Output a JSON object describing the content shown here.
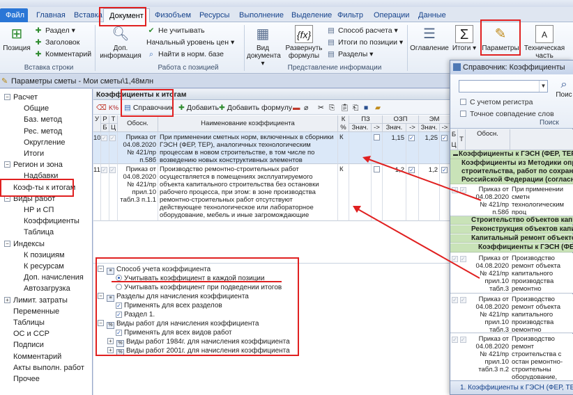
{
  "ribbon": {
    "tabs": [
      "Файл",
      "Главная",
      "Вставка",
      "Документ",
      "Физобъем",
      "Ресурсы",
      "Выполнение",
      "Выделение",
      "Фильтр",
      "Операции",
      "Данные"
    ],
    "insert_row": {
      "position": "Позиция",
      "section": "Раздел",
      "heading": "Заголовок",
      "comment": "Комментарий",
      "group": "Вставка строки"
    },
    "position_work": {
      "extra_info": "Доп. информация",
      "ignore": "Не учитывать",
      "price_level": "Начальный уровень цен",
      "find_norm": "Найти в норм. базе",
      "group": "Работа с позицией"
    },
    "info_view": {
      "doc_view": "Вид документа",
      "expand_formulas": "Развернуть формулы",
      "calc_method": "Способ расчета",
      "totals_by_pos": "Итоги по позиции",
      "sections": "Разделы",
      "group": "Представление информации"
    },
    "toc": "Оглавление",
    "totals": "Итоги",
    "params": "Параметры",
    "tech_part": "Техническая часть"
  },
  "document_tab": "Параметры сметы - Мои сметы\\1,48млн",
  "left_tree": [
    {
      "label": "Расчет",
      "level": 0,
      "toggle": "−"
    },
    {
      "label": "Общие",
      "level": 1
    },
    {
      "label": "Баз. метод",
      "level": 1
    },
    {
      "label": "Рес. метод",
      "level": 1
    },
    {
      "label": "Округление",
      "level": 1
    },
    {
      "label": "Итоги",
      "level": 1
    },
    {
      "label": "Регион и зона",
      "level": 0,
      "toggle": "−"
    },
    {
      "label": "Надбавки",
      "level": 1
    },
    {
      "label": "Коэф-ты к итогам",
      "level": 0
    },
    {
      "label": "Виды работ",
      "level": 0,
      "toggle": "−"
    },
    {
      "label": "НР и СП",
      "level": 1
    },
    {
      "label": "Коэффициенты",
      "level": 1
    },
    {
      "label": "Таблица",
      "level": 1
    },
    {
      "label": "Индексы",
      "level": 0,
      "toggle": "−"
    },
    {
      "label": "К позициям",
      "level": 1
    },
    {
      "label": "К ресурсам",
      "level": 1
    },
    {
      "label": "Доп. начисления",
      "level": 1
    },
    {
      "label": "Автозагрузка",
      "level": 1
    },
    {
      "label": "Лимит. затраты",
      "level": 0,
      "toggle": "+"
    },
    {
      "label": "Переменные",
      "level": 0
    },
    {
      "label": "Таблицы",
      "level": 0
    },
    {
      "label": "ОС и ССР",
      "level": 0
    },
    {
      "label": "Подписи",
      "level": 0
    },
    {
      "label": "Комментарий",
      "level": 0
    },
    {
      "label": "Акты выполн. работ",
      "level": 0
    },
    {
      "label": "Прочее",
      "level": 0
    }
  ],
  "mid": {
    "header": "Коэффициенты к итогам",
    "toolbar": {
      "catalog": "Справочник",
      "add": "Добавить",
      "add_formula": "Добавить формулу"
    },
    "grid": {
      "h_u": "У",
      "h_r": "Р",
      "h_t": "Т",
      "h_b": "Б",
      "h_ts": "Ц",
      "h_basis": "Обосн.",
      "h_name": "Наименование коэффициента",
      "h_kpct": "К %",
      "h_pz": "ПЗ",
      "h_ozp": "ОЗП",
      "h_em": "ЭМ",
      "h_val": "Знач.",
      "h_arrow": "->",
      "rows": [
        {
          "num": "10",
          "basis": "Приказ от 04.08.2020 № 421/пр п.58б",
          "name": "При применении сметных норм, включенных в сборники ГЭСН (ФЕР, ТЕР), аналогичных технологическим процессам в новом строительстве, в том числе по возведению новых конструктивных элементов",
          "k": "К",
          "ozp": "1,15",
          "em": "1,25"
        },
        {
          "num": "11",
          "basis": "Приказ от 04.08.2020 № 421/пр прил.10 табл.3 п.1.1",
          "name": "Производство ремонтно-строительных работ осуществляется в помещениях эксплуатируемого объекта капитального строительства без остановки рабочего процесса, при этом: в зоне производства ремонтно-строительных работ отсутствуют действующее технологическое или лабораторное оборудование, мебель и иные загромождающие помещения предметы",
          "k": "К",
          "ozp": "1,2",
          "em": "1,2"
        }
      ]
    },
    "options": {
      "method": "Способ учета коэффициента",
      "each_pos": "Учитывать коэффициент в каждой позиции",
      "on_summing": "Учитывать коэффициент при подведении итогов",
      "sections_head": "Разделы для начисления коэффициента",
      "all_sections": "Применять для всех разделов",
      "section1": "Раздел 1.",
      "worktypes_head": "Виды работ для начисления коэффициента",
      "all_worktypes": "Применять для всех видов работ",
      "wt1984": "Виды работ 1984г. для начисления коэффициента",
      "wt2001": "Виды работ 2001г. для начисления коэффициента"
    }
  },
  "right_window": {
    "title": "Справочник: Коэффициенты",
    "case_sensitive": "С учетом регистра",
    "exact_match": "Точное совпадение слов",
    "search_btn": "Поис",
    "search_group": "Поиск",
    "h_b": "Б",
    "h_ts": "Ц",
    "h_t": "Т",
    "h_basis": "Обосн.",
    "bands": [
      "Коэффициенты к ГЭСН (ФЕР, ТЕР)",
      "Коэффициенты из Методики опред",
      "строительства, работ по сохране",
      "Российской Федерации (согласно"
    ],
    "row1": {
      "basis": "Приказ от 04.08.2020 № 421/пр п.58б",
      "name": "При применении сметн технологическим проц конструктивных элеме"
    },
    "sub_bands": [
      "Строительство объектов капит",
      "Реконструкция объектов капи",
      "Капитальный ремонт объектов",
      "Коэффициенты к ГЭСН (ФЕР, Т"
    ],
    "rows": [
      {
        "basis": "Приказ от 04.08.2020 № 421/пр прил.10 табл.3",
        "name": "Производство ремонт объекта капитального производства ремонтно лабораторное оборудо"
      },
      {
        "basis": "Приказ от 04.08.2020 № 421/пр прил.10 табл.3",
        "name": "Производство ремонт объекта капитального производства ремонтно лабораторное оборудо"
      },
      {
        "basis": "Приказ от 04.08.2020 № 421/пр прил.10 табл.3 п.2",
        "name": "Производство ремонт строительства с остан ремонтно-строительны оборудование, мебель"
      }
    ],
    "footer": "1. Коэффициенты к ГЭСН (ФЕР, ТЕР)"
  },
  "colors": {
    "file_tab": "#2a76d6",
    "annotation_red": "#e02020",
    "band_green": "#c9e3b8",
    "selected_row": "#dbe8f8"
  }
}
